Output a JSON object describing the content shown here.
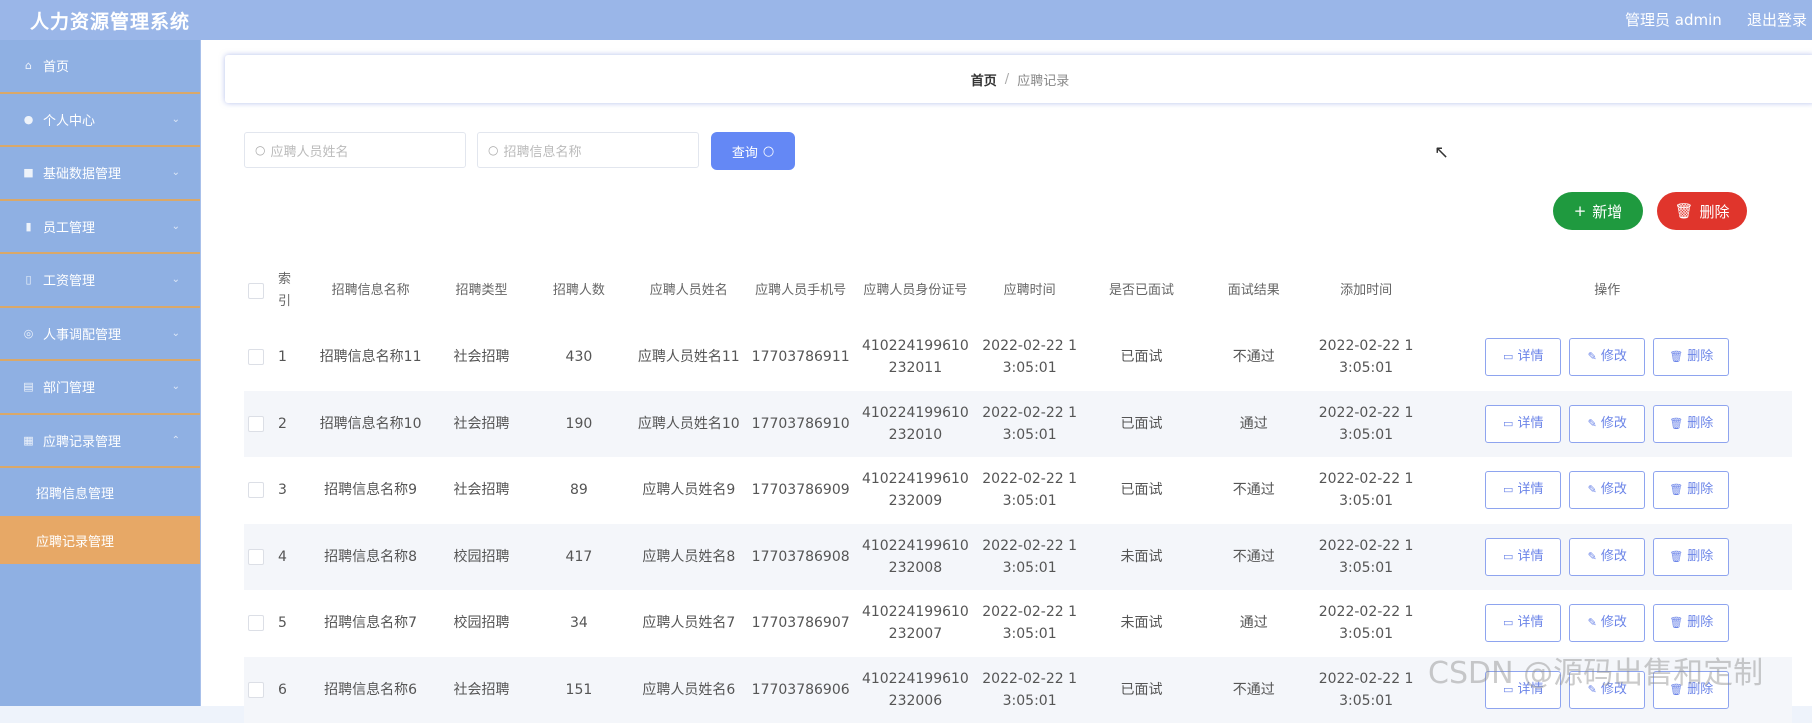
{
  "header": {
    "app_title": "人力资源管理系统",
    "admin_label": "管理员 admin",
    "logout_label": "退出登录"
  },
  "sidebar": {
    "items": [
      {
        "label": "首页",
        "icon": "home-icon"
      },
      {
        "label": "个人中心",
        "icon": "user-icon"
      },
      {
        "label": "基础数据管理",
        "icon": "database-icon"
      },
      {
        "label": "员工管理",
        "icon": "staff-icon"
      },
      {
        "label": "工资管理",
        "icon": "money-icon"
      },
      {
        "label": "人事调配管理",
        "icon": "transfer-icon"
      },
      {
        "label": "部门管理",
        "icon": "dept-icon"
      },
      {
        "label": "应聘记录管理",
        "icon": "record-icon"
      }
    ],
    "subitems": [
      {
        "label": "招聘信息管理",
        "active": false
      },
      {
        "label": "应聘记录管理",
        "active": true
      }
    ]
  },
  "breadcrumb": {
    "home": "首页",
    "separator": "/",
    "current": "应聘记录"
  },
  "search": {
    "name_placeholder": "应聘人员姓名",
    "info_placeholder": "招聘信息名称",
    "query_label": "查询"
  },
  "toolbar": {
    "add_label": "新增",
    "delete_label": "删除"
  },
  "table": {
    "columns": [
      "索引",
      "招聘信息名称",
      "招聘类型",
      "招聘人数",
      "应聘人员姓名",
      "应聘人员手机号",
      "应聘人员身份证号",
      "应聘时间",
      "是否已面试",
      "面试结果",
      "添加时间",
      "操作"
    ],
    "action_labels": {
      "detail": "详情",
      "edit": "修改",
      "delete": "删除"
    },
    "rows": [
      {
        "index": "1",
        "info": "招聘信息名称11",
        "type": "社会招聘",
        "count": "430",
        "name": "应聘人员姓名11",
        "phone": "17703786911",
        "idcard": "410224199610232011",
        "apply_time": "2022-02-22 13:05:01",
        "interviewed": "已面试",
        "result": "不通过",
        "add_time": "2022-02-22 13:05:01"
      },
      {
        "index": "2",
        "info": "招聘信息名称10",
        "type": "社会招聘",
        "count": "190",
        "name": "应聘人员姓名10",
        "phone": "17703786910",
        "idcard": "410224199610232010",
        "apply_time": "2022-02-22 13:05:01",
        "interviewed": "已面试",
        "result": "通过",
        "add_time": "2022-02-22 13:05:01"
      },
      {
        "index": "3",
        "info": "招聘信息名称9",
        "type": "社会招聘",
        "count": "89",
        "name": "应聘人员姓名9",
        "phone": "17703786909",
        "idcard": "410224199610232009",
        "apply_time": "2022-02-22 13:05:01",
        "interviewed": "已面试",
        "result": "不通过",
        "add_time": "2022-02-22 13:05:01"
      },
      {
        "index": "4",
        "info": "招聘信息名称8",
        "type": "校园招聘",
        "count": "417",
        "name": "应聘人员姓名8",
        "phone": "17703786908",
        "idcard": "410224199610232008",
        "apply_time": "2022-02-22 13:05:01",
        "interviewed": "未面试",
        "result": "不通过",
        "add_time": "2022-02-22 13:05:01"
      },
      {
        "index": "5",
        "info": "招聘信息名称7",
        "type": "校园招聘",
        "count": "34",
        "name": "应聘人员姓名7",
        "phone": "17703786907",
        "idcard": "410224199610232007",
        "apply_time": "2022-02-22 13:05:01",
        "interviewed": "未面试",
        "result": "通过",
        "add_time": "2022-02-22 13:05:01"
      },
      {
        "index": "6",
        "info": "招聘信息名称6",
        "type": "社会招聘",
        "count": "151",
        "name": "应聘人员姓名6",
        "phone": "17703786906",
        "idcard": "410224199610232006",
        "apply_time": "2022-02-22 13:05:01",
        "interviewed": "已面试",
        "result": "不通过",
        "add_time": "2022-02-22 13:05:01"
      }
    ]
  },
  "watermark": "CSDN @源码出售和定制",
  "colors": {
    "header_bg": "#9ab6e8",
    "sidebar_bg": "#8fb0e3",
    "active_submenu": "#e7a866",
    "primary": "#6488f5",
    "success": "#1f9a3f",
    "danger": "#e0352c"
  }
}
